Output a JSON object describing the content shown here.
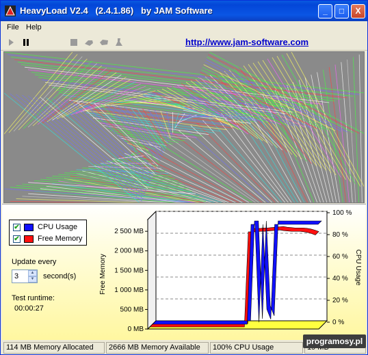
{
  "window": {
    "title": "HeavyLoad V2.4   (2.4.1.86)   by JAM Software"
  },
  "titlebar_buttons": {
    "minimize": "_",
    "maximize": "□",
    "close": "X"
  },
  "menu": [
    "File",
    "Help"
  ],
  "toolbar": {
    "url": "http://www.jam-software.com",
    "tools": [
      "play-icon",
      "pause-icon",
      "stop-icon",
      "cpu-icon",
      "memory-icon",
      "disk-icon"
    ]
  },
  "legend": {
    "items": [
      {
        "label": "CPU Usage",
        "color": "#1010ff",
        "checked": true
      },
      {
        "label": "Free Memory",
        "color": "#ff1010",
        "checked": true
      }
    ]
  },
  "update": {
    "label": "Update every",
    "value": "3",
    "unit": "second(s)"
  },
  "runtime": {
    "label": "Test runtime:",
    "value": "00:00:27"
  },
  "chart_data": {
    "type": "bar",
    "left_axis": {
      "label": "Free Memory",
      "ticks": [
        "0 MB",
        "500 MB",
        "1 000 MB",
        "1 500 MB",
        "2 000 MB",
        "2 500 MB"
      ],
      "range": [
        0,
        2800
      ]
    },
    "right_axis": {
      "label": "CPU Usage",
      "ticks": [
        "0 %",
        "20 %",
        "40 %",
        "60 %",
        "80 %",
        "100 %"
      ],
      "range": [
        0,
        100
      ]
    },
    "series": [
      {
        "name": "CPU Usage",
        "color": "#1010ff",
        "values": [
          0,
          0,
          0,
          0,
          0,
          0,
          0,
          0,
          0,
          0,
          0,
          0,
          0,
          0,
          0,
          0,
          0,
          0,
          0,
          0,
          0,
          0,
          0,
          0,
          0,
          100,
          100,
          2,
          100,
          15,
          5,
          100,
          100,
          100,
          100,
          100,
          100,
          100,
          100,
          100,
          100,
          100,
          100
        ]
      },
      {
        "name": "Free Memory",
        "color": "#ff1010",
        "values": [
          0,
          0,
          0,
          0,
          0,
          0,
          0,
          0,
          0,
          0,
          0,
          0,
          0,
          0,
          0,
          0,
          0,
          0,
          0,
          0,
          0,
          0,
          0,
          0,
          0,
          2666,
          2666,
          2666,
          2680,
          2680,
          2690,
          2700,
          2710,
          2720,
          2700,
          2690,
          2680,
          2680,
          2680,
          2670,
          2650,
          2620,
          2580
        ]
      }
    ]
  },
  "status": {
    "memory_allocated": "114 MB Memory Allocated",
    "memory_available": "2666 MB Memory Available",
    "cpu_usage": "100% CPU Usage",
    "extra": "19 MB"
  },
  "watermark": "programosy.pl"
}
